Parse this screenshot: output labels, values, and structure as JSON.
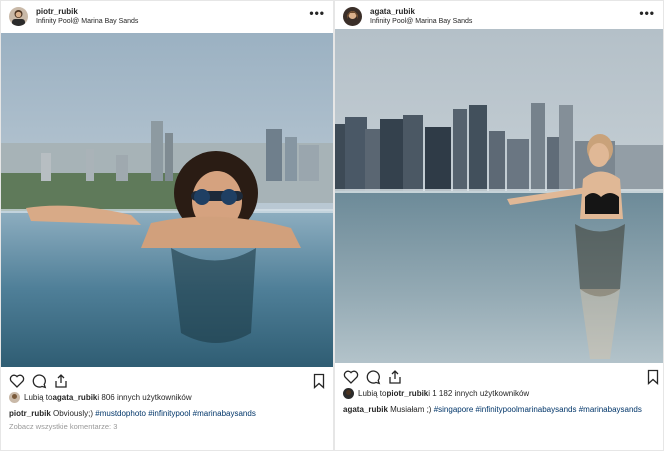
{
  "posts": [
    {
      "username": "piotr_rubik",
      "location": "Infinity Pool@ Marina Bay Sands",
      "more_glyph": "•••",
      "likes_prefix": "Lubią to ",
      "likes_user": "agata_rubik",
      "likes_suffix": " i 806 innych użytkowników",
      "caption_user": "piotr_rubik",
      "caption_text": " Obviously;) ",
      "hashtags": [
        "#mustdophoto",
        "#infinitypool",
        "#marinabaysands"
      ],
      "view_all": "Zobacz wszystkie komentarze: 3"
    },
    {
      "username": "agata_rubik",
      "location": "Infinity Pool@ Marina Bay Sands",
      "more_glyph": "•••",
      "likes_prefix": "Lubią to ",
      "likes_user": "piotr_rubik",
      "likes_suffix": " i 1 182 innych użytkowników",
      "caption_user": "agata_rubik",
      "caption_text": " Musiałam ;) ",
      "hashtags": [
        "#singapore",
        "#infinitypoolmarinabaysands",
        "#marinabaysands"
      ]
    }
  ],
  "icons": [
    "heart-icon",
    "comment-icon",
    "share-icon",
    "bookmark-icon"
  ],
  "colors": {
    "hashtag": "#003569",
    "text": "#262626",
    "muted": "#999999",
    "border": "#e6e6e6"
  }
}
